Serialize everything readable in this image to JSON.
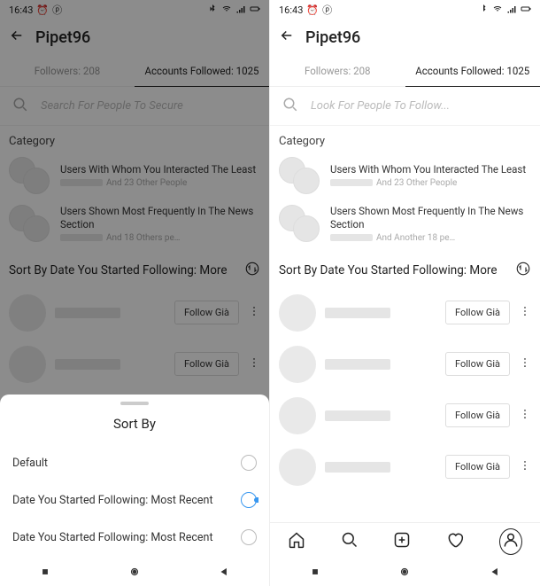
{
  "status": {
    "time": "16:43",
    "icons": [
      "alarm",
      "pinterest"
    ],
    "right": [
      "bluetooth",
      "wifi",
      "signal",
      "battery"
    ]
  },
  "title": "Pipet96",
  "tabs": {
    "followers": "Followers: 208",
    "following": "Accounts Followed: 1025"
  },
  "search": {
    "left_placeholder": "Search For People To Secure",
    "right_placeholder": "Look For People To Follow..."
  },
  "category_label": "Category",
  "categories": [
    {
      "title": "Users With Whom You Interacted The Least",
      "subtitle": "And 23 Other People"
    },
    {
      "title": "Users Shown Most Frequently In The News Section",
      "subtitle_left": "And 18 Others pe…",
      "subtitle_right": "And Another 18 pe…"
    }
  ],
  "sort_label": "Sort By Date You Started Following: More",
  "follow_button": "Follow Già",
  "sheet": {
    "title": "Sort By",
    "options": [
      {
        "label": "Default",
        "selected": false
      },
      {
        "label": "Date You Started Following: Most Recent",
        "selected": true
      },
      {
        "label": "Date You Started Following: Most Recent",
        "selected": false
      }
    ]
  }
}
